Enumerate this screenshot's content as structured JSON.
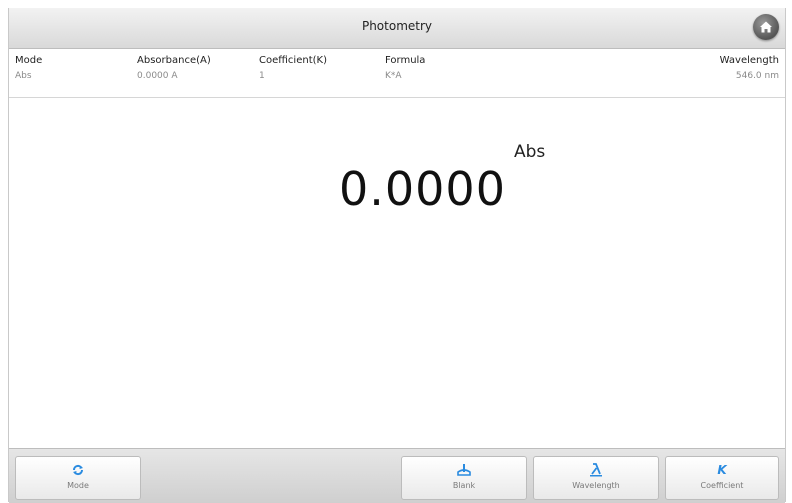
{
  "header": {
    "title": "Photometry",
    "home_icon": "home-icon"
  },
  "info": {
    "mode": {
      "label": "Mode",
      "value": "Abs"
    },
    "absorbance": {
      "label": "Absorbance(A)",
      "value": "0.0000 A"
    },
    "coefficient": {
      "label": "Coefficient(K)",
      "value": "1"
    },
    "formula": {
      "label": "Formula",
      "value": "K*A"
    },
    "wavelength": {
      "label": "Wavelength",
      "value": "546.0 nm"
    }
  },
  "display": {
    "unit": "Abs",
    "reading": "0.0000"
  },
  "toolbar": {
    "mode": {
      "label": "Mode",
      "icon": "refresh-icon"
    },
    "blank": {
      "label": "Blank",
      "icon": "blank-icon"
    },
    "wavelength": {
      "label": "Wavelength",
      "icon": "lambda-icon"
    },
    "coefficient": {
      "label": "Coefficient",
      "icon": "k-icon",
      "glyph": "K"
    }
  },
  "colors": {
    "accent": "#2a8be0"
  }
}
